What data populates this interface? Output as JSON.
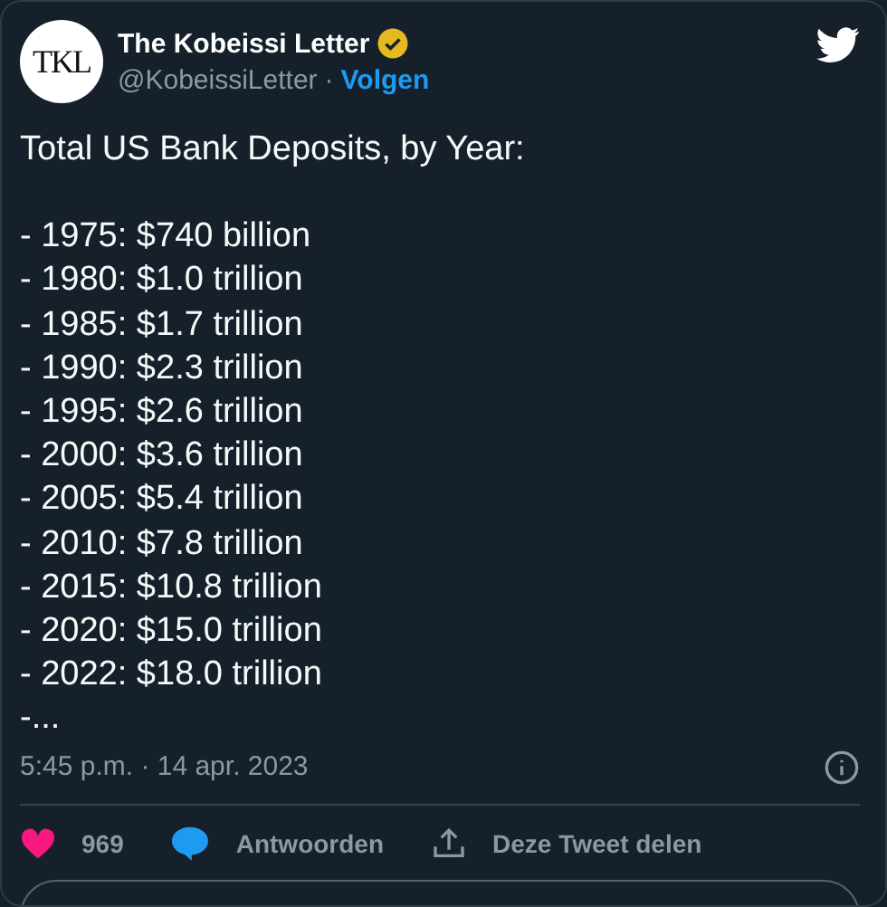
{
  "author": {
    "name": "The Kobeissi Letter",
    "handle": "@KobeissiLetter",
    "separator": "·",
    "follow": "Volgen",
    "avatar_text": "TKL",
    "verified": true
  },
  "title": "Total US Bank Deposits, by Year:",
  "body": [
    "- 1975: $740 billion",
    "- 1980: $1.0 trillion",
    "- 1985: $1.7 trillion",
    "- 1990: $2.3 trillion",
    "- 1995: $2.6 trillion",
    "- 2000: $3.6 trillion",
    "- 2005: $5.4 trillion",
    "- 2010: $7.8 trillion",
    "- 2015: $10.8 trillion",
    "- 2020: $15.0 trillion",
    "- 2022: $18.0 trillion",
    "-..."
  ],
  "timestamp": "5:45 p.m. · 14 apr. 2023",
  "actions": [
    {
      "kind": "like",
      "label": "969"
    },
    {
      "kind": "reply",
      "label": "Antwoorden"
    },
    {
      "kind": "share",
      "label": "Deze Tweet delen"
    }
  ]
}
